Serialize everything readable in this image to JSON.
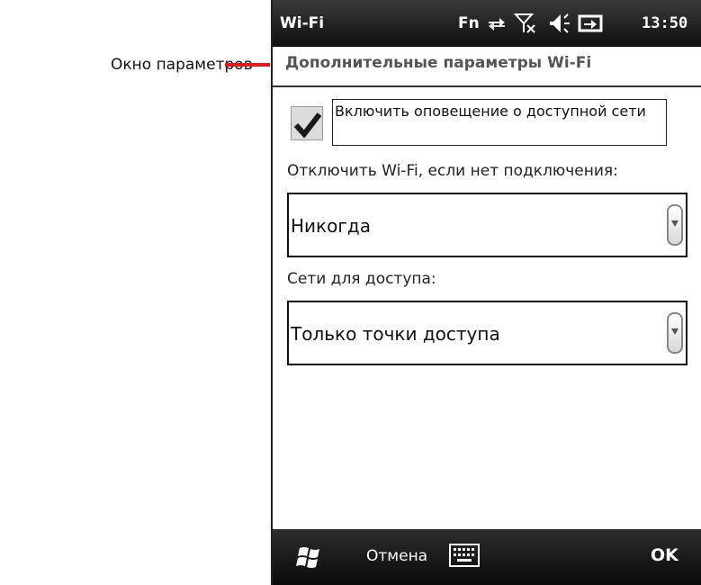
{
  "annotation": {
    "label": "Окно параметров",
    "line_color": "#e8151b"
  },
  "status_bar": {
    "title": "Wi-Fi",
    "fn_label": "Fn",
    "time": "13:50",
    "icons": [
      "connectivity-icon",
      "no-signal-icon",
      "volume-icon",
      "battery-charging-icon"
    ]
  },
  "header": {
    "title": "Дополнительные параметры Wi-Fi"
  },
  "settings": {
    "notify_checkbox": {
      "label": "Включить оповещение о доступной сети",
      "checked": true
    },
    "disconnect": {
      "label": "Отключить Wi-Fi, если нет подключения:",
      "value": "Никогда"
    },
    "networks": {
      "label": "Сети для доступа:",
      "value": "Только точки доступа"
    }
  },
  "softbar": {
    "cancel_label": "Отмена",
    "ok_label": "OK",
    "icons": [
      "windows-start-icon",
      "keyboard-icon"
    ]
  },
  "colors": {
    "statusbar_bg": "#1a1a1a",
    "softbar_bg": "#1a1a1a",
    "accent_red": "#e8151b"
  }
}
